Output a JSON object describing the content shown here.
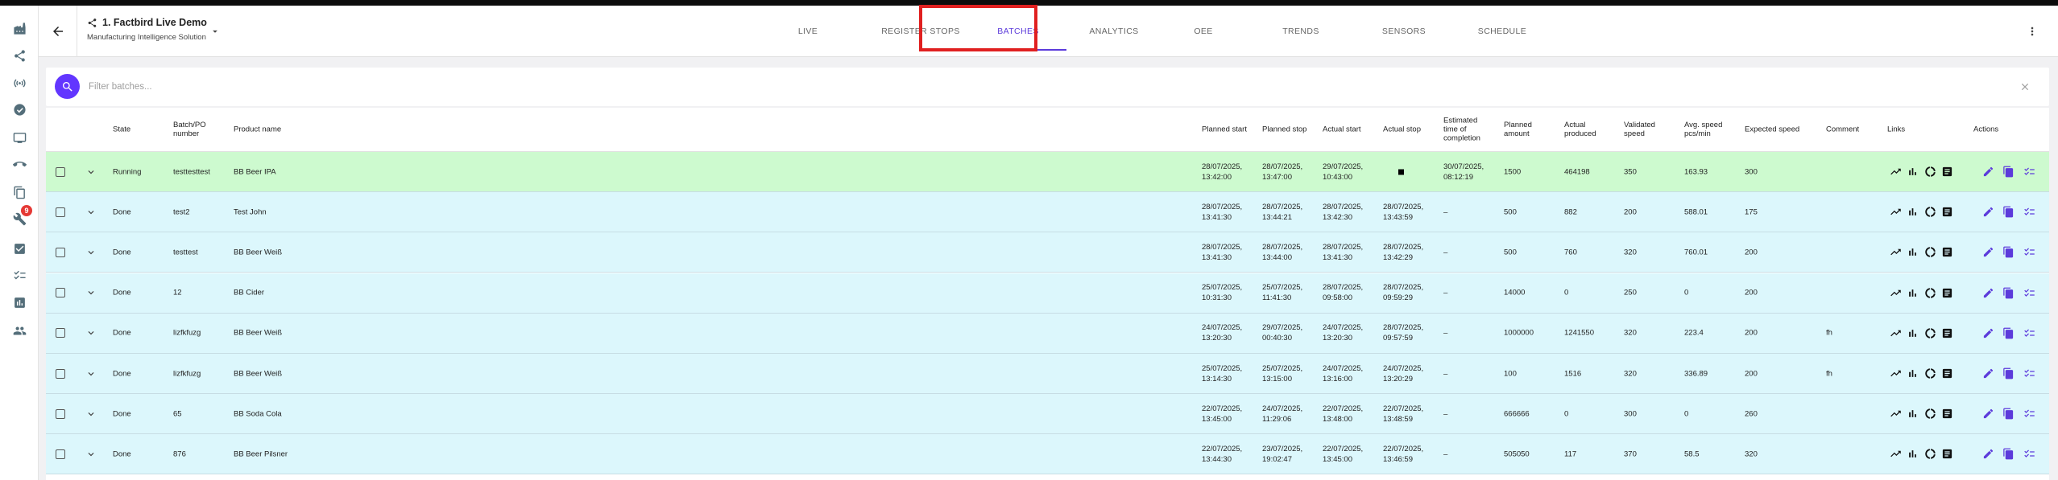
{
  "header": {
    "title": "1. Factbird Live Demo",
    "subtitle": "Manufacturing Intelligence Solution"
  },
  "tabs": [
    {
      "label": "LIVE"
    },
    {
      "label": "REGISTER STOPS"
    },
    {
      "label": "BATCHES"
    },
    {
      "label": "ANALYTICS"
    },
    {
      "label": "OEE"
    },
    {
      "label": "TRENDS"
    },
    {
      "label": "SENSORS"
    },
    {
      "label": "SCHEDULE"
    }
  ],
  "active_tab": "BATCHES",
  "rail": {
    "items": [
      "factory-icon",
      "share-icon",
      "sensor-icon",
      "speed-icon",
      "monitor-icon",
      "phone-icon",
      "docs-icon",
      "wrench-icon",
      "checkbox-icon",
      "checklist-icon",
      "report-icon",
      "people-icon"
    ],
    "badge": "9"
  },
  "search": {
    "placeholder": "Filter batches..."
  },
  "columns": {
    "state": "State",
    "batch": "Batch/PO number",
    "product": "Product name",
    "planned_start": "Planned start",
    "planned_stop": "Planned stop",
    "actual_start": "Actual start",
    "actual_stop": "Actual stop",
    "estimated": "Estimated time of completion",
    "planned_amount": "Planned amount",
    "actual_produced": "Actual produced",
    "validated_speed": "Validated speed",
    "avg_speed": "Avg. speed pcs/min",
    "expected_speed": "Expected speed",
    "comment": "Comment",
    "links": "Links",
    "actions": "Actions"
  },
  "rows": [
    {
      "state": "Running",
      "batch": "testtesttest",
      "product": "BB Beer IPA",
      "planned_start": [
        "28/07/2025,",
        "13:42:00"
      ],
      "planned_stop": [
        "28/07/2025,",
        "13:47:00"
      ],
      "actual_start": [
        "29/07/2025,",
        "10:43:00"
      ],
      "actual_stop": [
        "",
        ""
      ],
      "estimated": [
        "30/07/2025,",
        "08:12:19"
      ],
      "planned_amount": "1500",
      "actual_produced": "464198",
      "validated_speed": "350",
      "avg_speed": "163.93",
      "expected_speed": "300",
      "comment": ""
    },
    {
      "state": "Done",
      "batch": "test2",
      "product": "Test John",
      "planned_start": [
        "28/07/2025,",
        "13:41:30"
      ],
      "planned_stop": [
        "28/07/2025,",
        "13:44:21"
      ],
      "actual_start": [
        "28/07/2025,",
        "13:42:30"
      ],
      "actual_stop": [
        "28/07/2025,",
        "13:43:59"
      ],
      "estimated": [
        "–",
        ""
      ],
      "planned_amount": "500",
      "actual_produced": "882",
      "validated_speed": "200",
      "avg_speed": "588.01",
      "expected_speed": "175",
      "comment": ""
    },
    {
      "state": "Done",
      "batch": "testtest",
      "product": "BB Beer Weiß",
      "planned_start": [
        "28/07/2025,",
        "13:41:30"
      ],
      "planned_stop": [
        "28/07/2025,",
        "13:44:00"
      ],
      "actual_start": [
        "28/07/2025,",
        "13:41:30"
      ],
      "actual_stop": [
        "28/07/2025,",
        "13:42:29"
      ],
      "estimated": [
        "–",
        ""
      ],
      "planned_amount": "500",
      "actual_produced": "760",
      "validated_speed": "320",
      "avg_speed": "760.01",
      "expected_speed": "200",
      "comment": ""
    },
    {
      "state": "Done",
      "batch": "12",
      "product": "BB Cider",
      "planned_start": [
        "25/07/2025,",
        "10:31:30"
      ],
      "planned_stop": [
        "25/07/2025,",
        "11:41:30"
      ],
      "actual_start": [
        "28/07/2025,",
        "09:58:00"
      ],
      "actual_stop": [
        "28/07/2025,",
        "09:59:29"
      ],
      "estimated": [
        "–",
        ""
      ],
      "planned_amount": "14000",
      "actual_produced": "0",
      "validated_speed": "250",
      "avg_speed": "0",
      "expected_speed": "200",
      "comment": ""
    },
    {
      "state": "Done",
      "batch": "lizfkfuzg",
      "product": "BB Beer Weiß",
      "planned_start": [
        "24/07/2025,",
        "13:20:30"
      ],
      "planned_stop": [
        "29/07/2025,",
        "00:40:30"
      ],
      "actual_start": [
        "24/07/2025,",
        "13:20:30"
      ],
      "actual_stop": [
        "28/07/2025,",
        "09:57:59"
      ],
      "estimated": [
        "–",
        ""
      ],
      "planned_amount": "1000000",
      "actual_produced": "1241550",
      "validated_speed": "320",
      "avg_speed": "223.4",
      "expected_speed": "200",
      "comment": "fh"
    },
    {
      "state": "Done",
      "batch": "lizfkfuzg",
      "product": "BB Beer Weiß",
      "planned_start": [
        "25/07/2025,",
        "13:14:30"
      ],
      "planned_stop": [
        "25/07/2025,",
        "13:15:00"
      ],
      "actual_start": [
        "24/07/2025,",
        "13:16:00"
      ],
      "actual_stop": [
        "24/07/2025,",
        "13:20:29"
      ],
      "estimated": [
        "–",
        ""
      ],
      "planned_amount": "100",
      "actual_produced": "1516",
      "validated_speed": "320",
      "avg_speed": "336.89",
      "expected_speed": "200",
      "comment": "fh"
    },
    {
      "state": "Done",
      "batch": "65",
      "product": "BB Soda Cola",
      "planned_start": [
        "22/07/2025,",
        "13:45:00"
      ],
      "planned_stop": [
        "24/07/2025,",
        "11:29:06"
      ],
      "actual_start": [
        "22/07/2025,",
        "13:48:00"
      ],
      "actual_stop": [
        "22/07/2025,",
        "13:48:59"
      ],
      "estimated": [
        "–",
        ""
      ],
      "planned_amount": "666666",
      "actual_produced": "0",
      "validated_speed": "300",
      "avg_speed": "0",
      "expected_speed": "260",
      "comment": ""
    },
    {
      "state": "Done",
      "batch": "876",
      "product": "BB Beer Pilsner",
      "planned_start": [
        "22/07/2025,",
        "13:44:30"
      ],
      "planned_stop": [
        "23/07/2025,",
        "19:02:47"
      ],
      "actual_start": [
        "22/07/2025,",
        "13:45:00"
      ],
      "actual_stop": [
        "22/07/2025,",
        "13:46:59"
      ],
      "estimated": [
        "–",
        ""
      ],
      "planned_amount": "505050",
      "actual_produced": "117",
      "validated_speed": "370",
      "avg_speed": "58.5",
      "expected_speed": "320",
      "comment": ""
    }
  ],
  "row_icons": {
    "links": [
      "trend-icon",
      "bar-chart-icon",
      "donut-icon",
      "list-icon"
    ],
    "actions": [
      "edit-icon",
      "copy-icon",
      "checklist-icon"
    ]
  },
  "colors": {
    "accent": "#5c3bdb",
    "running_row": "#cdfacf",
    "done_row": "#dcf7fc",
    "highlight": "#e02020"
  }
}
